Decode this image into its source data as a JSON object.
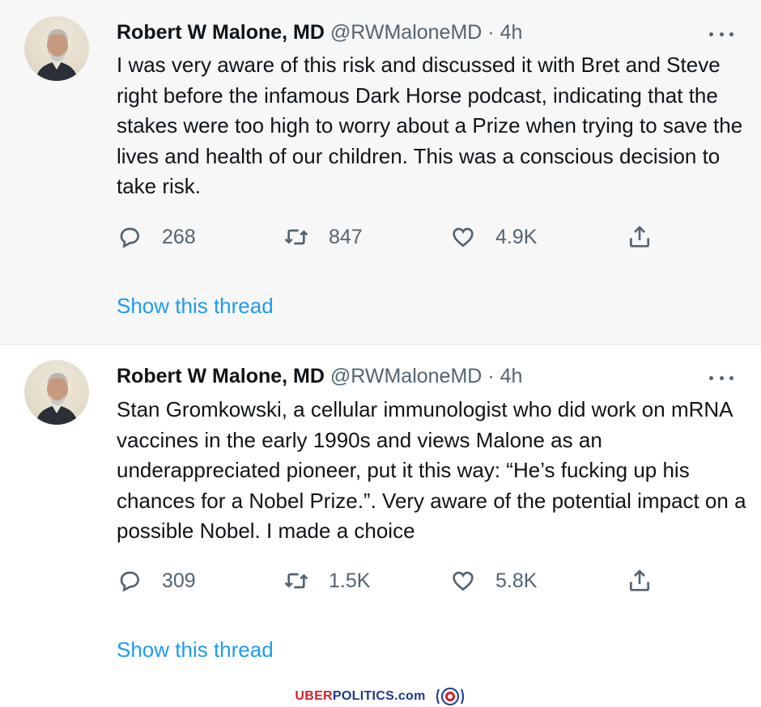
{
  "tweets": [
    {
      "author_name": "Robert W Malone, MD",
      "handle": "@RWMaloneMD",
      "separator": "·",
      "time": "4h",
      "text": "I was very aware of this risk and discussed it with Bret and Steve right before the infamous Dark Horse podcast, indicating that the stakes were too high to worry about a Prize when trying to save the lives and health of our children. This was a conscious decision to take risk.",
      "replies": "268",
      "retweets": "847",
      "likes": "4.9K",
      "thread_link": "Show this thread"
    },
    {
      "author_name": "Robert W Malone, MD",
      "handle": "@RWMaloneMD",
      "separator": "·",
      "time": "4h",
      "text": "Stan Gromkowski, a cellular immunologist who did work on mRNA vaccines in the early 1990s and views Malone as an underappreciated pioneer,  put it this way: “He’s fucking up his chances for a Nobel Prize.”.  Very aware of the potential impact on a possible Nobel.  I made a choice",
      "replies": "309",
      "retweets": "1.5K",
      "likes": "5.8K",
      "thread_link": "Show this thread"
    }
  ],
  "icons": {
    "reply": "reply-bubble-icon",
    "retweet": "retweet-arrows-icon",
    "like": "heart-icon",
    "share": "share-upload-icon",
    "more": "more-dots-icon"
  },
  "watermark": {
    "part1": "UBER",
    "part2": "POLITICS",
    "part3": ".com"
  },
  "colors": {
    "link": "#1d9bf0",
    "secondary_text": "#536471",
    "watermark_red": "#d4202a",
    "watermark_blue": "#1b3a8c"
  }
}
